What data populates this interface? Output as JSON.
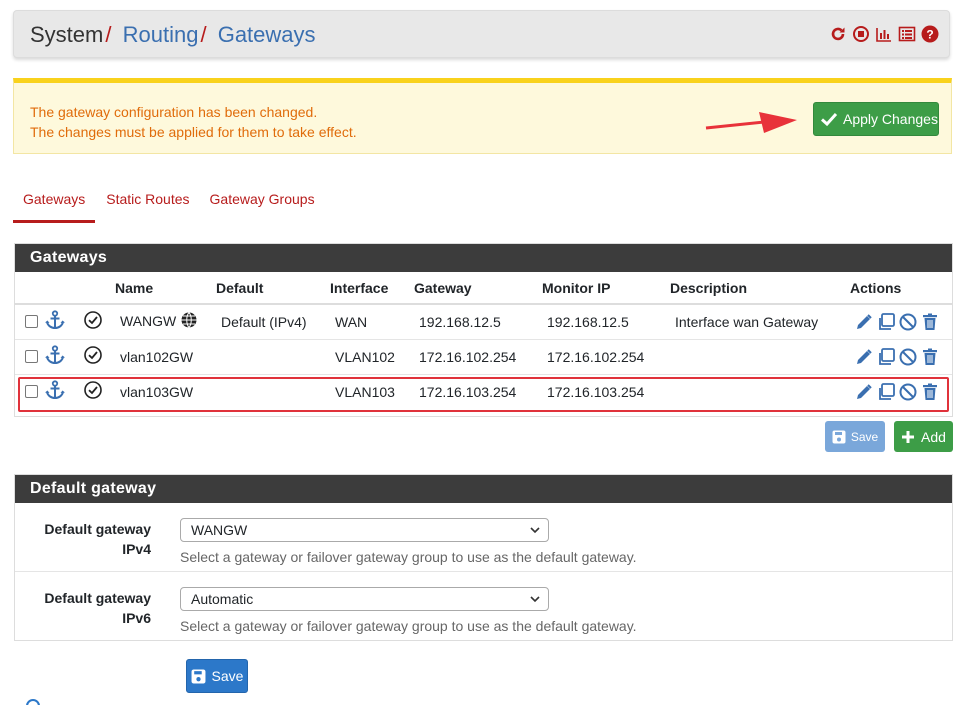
{
  "breadcrumb": {
    "root": "System",
    "sep": "/",
    "level1": "Routing",
    "level2": "Gateways"
  },
  "header_icons": [
    "reload-icon",
    "stop-icon",
    "chart-icon",
    "list-icon",
    "help-icon"
  ],
  "alert": {
    "line1": "The gateway configuration has been changed.",
    "line2": "The changes must be applied for them to take effect.",
    "apply_label": "Apply Changes"
  },
  "tabs": [
    {
      "label": "Gateways",
      "active": true
    },
    {
      "label": "Static Routes",
      "active": false
    },
    {
      "label": "Gateway Groups",
      "active": false
    }
  ],
  "gateways": {
    "title": "Gateways",
    "columns": [
      "Name",
      "Default",
      "Interface",
      "Gateway",
      "Monitor IP",
      "Description",
      "Actions"
    ],
    "rows": [
      {
        "name": "WANGW",
        "default": "Default (IPv4)",
        "interface": "WAN",
        "gateway": "192.168.12.5",
        "monitor": "192.168.12.5",
        "description": "Interface wan Gateway"
      },
      {
        "name": "vlan102GW",
        "default": "",
        "interface": "VLAN102",
        "gateway": "172.16.102.254",
        "monitor": "172.16.102.254",
        "description": ""
      },
      {
        "name": "vlan103GW",
        "default": "",
        "interface": "VLAN103",
        "gateway": "172.16.103.254",
        "monitor": "172.16.103.254",
        "description": ""
      }
    ],
    "save_label": "Save",
    "add_label": "Add"
  },
  "default_gateway": {
    "title": "Default gateway",
    "ipv4": {
      "label1": "Default gateway",
      "label2": "IPv4",
      "value": "WANGW",
      "help": "Select a gateway or failover gateway group to use as the default gateway."
    },
    "ipv6": {
      "label1": "Default gateway",
      "label2": "IPv6",
      "value": "Automatic",
      "help": "Select a gateway or failover gateway group to use as the default gateway."
    },
    "save_label": "Save"
  },
  "colors": {
    "brand_red": "#b71c1c",
    "link_blue": "#3a6fb0",
    "success": "#3d9d47",
    "primary": "#2c78c9",
    "warning_text": "#e06c0b"
  }
}
